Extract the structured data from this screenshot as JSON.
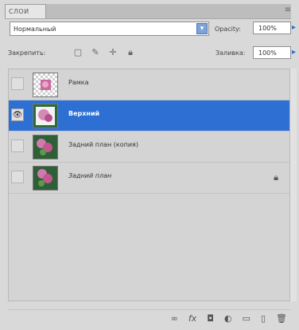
{
  "panel": {
    "tab_title": "СЛОИ",
    "menu_icon": "panel-menu-icon"
  },
  "controls": {
    "blend_mode": "Нормальный",
    "opacity_label": "Opacity:",
    "opacity_value": "100%",
    "lock_label": "Закрепить:",
    "fill_label": "Заливка:",
    "fill_value": "100%"
  },
  "layers": [
    {
      "name": "Рамка",
      "visible": false,
      "selected": false,
      "locked": false,
      "italic": false
    },
    {
      "name": "Верхний",
      "visible": true,
      "selected": true,
      "locked": false,
      "italic": false
    },
    {
      "name": "Задний план (копия)",
      "visible": false,
      "selected": false,
      "locked": false,
      "italic": false
    },
    {
      "name": "Задний план",
      "visible": false,
      "selected": false,
      "locked": true,
      "italic": true
    }
  ],
  "colors": {
    "selection": "#2e6fd4",
    "panel_bg": "#d9d9d9"
  }
}
